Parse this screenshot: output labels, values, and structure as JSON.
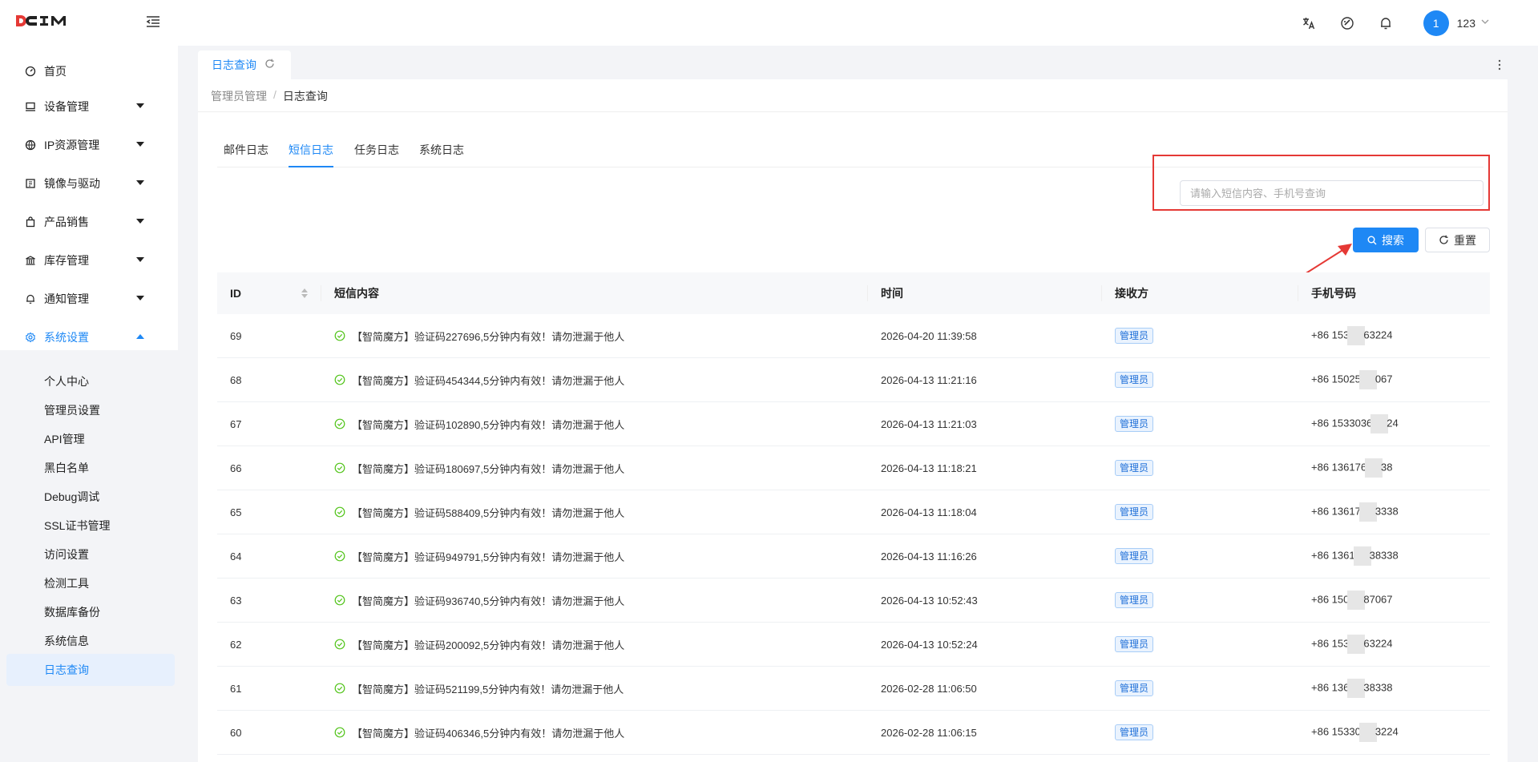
{
  "header": {
    "logo_text": "DCIM",
    "user": {
      "avatar_text": "1",
      "name": "123"
    },
    "colors": {
      "brand_red": "#e53935",
      "accent": "#1e88f5"
    }
  },
  "sidebar": {
    "items": [
      {
        "label": "首页",
        "icon": "dashboard-icon",
        "expandable": false
      },
      {
        "label": "设备管理",
        "icon": "laptop-icon",
        "expandable": true
      },
      {
        "label": "IP资源管理",
        "icon": "network-icon",
        "expandable": true
      },
      {
        "label": "镜像与驱动",
        "icon": "image-icon",
        "expandable": true
      },
      {
        "label": "产品销售",
        "icon": "bag-icon",
        "expandable": true
      },
      {
        "label": "库存管理",
        "icon": "bank-icon",
        "expandable": true
      },
      {
        "label": "通知管理",
        "icon": "bell-icon",
        "expandable": true
      },
      {
        "label": "系统设置",
        "icon": "gear-icon",
        "expandable": true,
        "open": true
      }
    ],
    "submenu": [
      {
        "label": "个人中心"
      },
      {
        "label": "管理员设置"
      },
      {
        "label": "API管理"
      },
      {
        "label": "黑白名单"
      },
      {
        "label": "Debug调试"
      },
      {
        "label": "SSL证书管理"
      },
      {
        "label": "访问设置"
      },
      {
        "label": "检测工具"
      },
      {
        "label": "数据库备份"
      },
      {
        "label": "系统信息"
      },
      {
        "label": "日志查询",
        "active": true
      }
    ]
  },
  "page_tab": {
    "label": "日志查询"
  },
  "breadcrumb": {
    "parent": "管理员管理",
    "sep": "/",
    "current": "日志查询"
  },
  "log_tabs": [
    {
      "label": "邮件日志"
    },
    {
      "label": "短信日志",
      "active": true
    },
    {
      "label": "任务日志"
    },
    {
      "label": "系统日志"
    }
  ],
  "search": {
    "placeholder": "请输入短信内容、手机号查询",
    "value": "",
    "search_label": "搜索",
    "reset_label": "重置"
  },
  "table": {
    "columns": [
      "ID",
      "短信内容",
      "时间",
      "接收方",
      "手机号码"
    ],
    "rows": [
      {
        "id": "69",
        "content": "【智简魔方】验证码227696,5分钟内有效！请勿泄漏于他人",
        "time": "2026-04-20 11:39:58",
        "receiver": "管理员",
        "phone_pre": "+86 153",
        "phone_post": "63224"
      },
      {
        "id": "68",
        "content": "【智简魔方】验证码454344,5分钟内有效！请勿泄漏于他人",
        "time": "2026-04-13 11:21:16",
        "receiver": "管理员",
        "phone_pre": "+86 15025",
        "phone_post": "067"
      },
      {
        "id": "67",
        "content": "【智简魔方】验证码102890,5分钟内有效！请勿泄漏于他人",
        "time": "2026-04-13 11:21:03",
        "receiver": "管理员",
        "phone_pre": "+86 1533036",
        "phone_post": "24"
      },
      {
        "id": "66",
        "content": "【智简魔方】验证码180697,5分钟内有效！请勿泄漏于他人",
        "time": "2026-04-13 11:18:21",
        "receiver": "管理员",
        "phone_pre": "+86 136176",
        "phone_post": "38"
      },
      {
        "id": "65",
        "content": "【智简魔方】验证码588409,5分钟内有效！请勿泄漏于他人",
        "time": "2026-04-13 11:18:04",
        "receiver": "管理员",
        "phone_pre": "+86 13617",
        "phone_post": "3338"
      },
      {
        "id": "64",
        "content": "【智简魔方】验证码949791,5分钟内有效！请勿泄漏于他人",
        "time": "2026-04-13 11:16:26",
        "receiver": "管理员",
        "phone_pre": "+86 1361",
        "phone_post": "38338"
      },
      {
        "id": "63",
        "content": "【智简魔方】验证码936740,5分钟内有效！请勿泄漏于他人",
        "time": "2026-04-13 10:52:43",
        "receiver": "管理员",
        "phone_pre": "+86 150",
        "phone_post": "87067"
      },
      {
        "id": "62",
        "content": "【智简魔方】验证码200092,5分钟内有效！请勿泄漏于他人",
        "time": "2026-04-13 10:52:24",
        "receiver": "管理员",
        "phone_pre": "+86 153",
        "phone_post": "63224"
      },
      {
        "id": "61",
        "content": "【智简魔方】验证码521199,5分钟内有效！请勿泄漏于他人",
        "time": "2026-02-28 11:06:50",
        "receiver": "管理员",
        "phone_pre": "+86 136",
        "phone_post": "38338"
      },
      {
        "id": "60",
        "content": "【智简魔方】验证码406346,5分钟内有效！请勿泄漏于他人",
        "time": "2026-02-28 11:06:15",
        "receiver": "管理员",
        "phone_pre": "+86 15330",
        "phone_post": "3224"
      }
    ]
  }
}
